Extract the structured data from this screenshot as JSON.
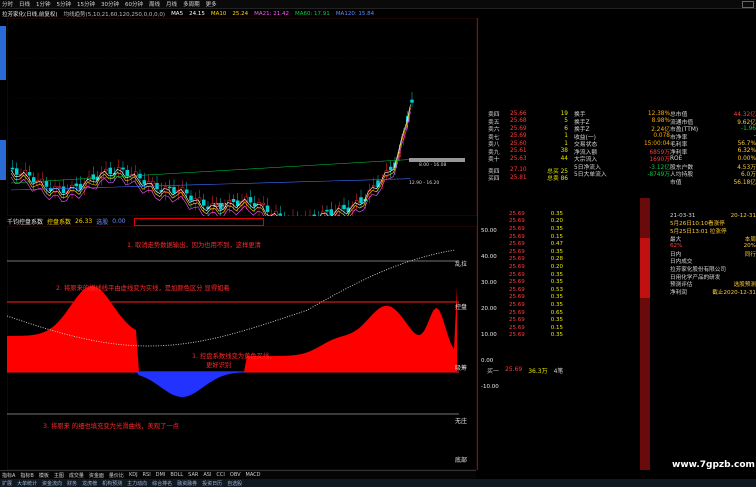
{
  "menu": [
    "分时",
    "日线",
    "1分钟",
    "5分钟",
    "15分钟",
    "30分钟",
    "60分钟",
    "周线",
    "月线",
    "多周期",
    "更多"
  ],
  "title": {
    "stock": "拉芳家化(日线,前复权)",
    "indicator": "均线趋势(5,10,21,60,120,250,0,0,0,0)",
    "ma5_label": "MA5",
    "ma5": "24.15",
    "ma10_label": "MA10",
    "ma10": "25.24",
    "ma21": "MA21: 21.42",
    "ma60": "MA60: 17.91",
    "ma120": "MA120: 15.84"
  },
  "chart_marks": {
    "price_high_tag": "↑",
    "low_label": "13.41",
    "box_labels": [
      "8.00 - 16.08",
      "12.90 - 16.20"
    ]
  },
  "indicator_header": {
    "name": "千钧控盘系数",
    "line1_label": "控盘系数",
    "line1_value": "26.33",
    "line2_label": "选股",
    "line2_value": "0.00"
  },
  "indicator_axis": [
    "50.00",
    "40.00",
    "30.00",
    "20.00",
    "10.00",
    "0.00",
    "-10.00"
  ],
  "indicator_zones": [
    "乱拉",
    "控盘",
    "吸筹",
    "无庄",
    "底部"
  ],
  "annotations": [
    "1. 取消走势数据输出，因为也用不到，这样更清",
    "2. 将原来的横线线平由虚线变为实线，是加颜色区分 显得如着",
    "1. 控盘系数线变为黄色叉线，",
    "更好识别",
    "3. 将原来 的细也填充变为光滑曲线，美观了一点"
  ],
  "bottom_tabs": [
    "指标A",
    "指标B",
    "模板",
    "主图",
    "成交量",
    "资金面",
    "量价比",
    "KDJ",
    "RSI",
    "DMI",
    "BOLL",
    "SAR",
    "ASI",
    "CCI",
    "OBV",
    "MACD"
  ],
  "status_tabs": [
    "扩展",
    "大单统计",
    "资金流向",
    "财务",
    "龙虎榜",
    "机构预测",
    "主力动向",
    "综合排名",
    "融资融券",
    "投资日历",
    "自选股"
  ],
  "order_book": {
    "sell": [
      {
        "label": "卖四",
        "price": "25.66",
        "vol": "19"
      },
      {
        "label": "卖五",
        "price": "25.68",
        "vol": "5"
      },
      {
        "label": "卖六",
        "price": "25.69",
        "vol": "6"
      },
      {
        "label": "卖七",
        "price": "25.69",
        "vol": "1"
      },
      {
        "label": "卖八",
        "price": "25.60",
        "vol": "1"
      },
      {
        "label": "卖九",
        "price": "25.61",
        "vol": "38"
      },
      {
        "label": "卖十",
        "price": "25.63",
        "vol": "44"
      }
    ],
    "buy": [
      {
        "label": "卖四",
        "price": "27.10",
        "vol": "总买 25"
      },
      {
        "label": "买四",
        "price": "25.81",
        "vol": "总卖 86"
      }
    ]
  },
  "quote_info": [
    {
      "k": "换手",
      "v": "12.38%"
    },
    {
      "k": "换手Z",
      "v": "8.98%"
    },
    {
      "k": "换手Z",
      "v": "2.24亿"
    },
    {
      "k": "收益(一)",
      "v": "0.078"
    },
    {
      "k": "交易状态",
      "v": "15:00:04"
    },
    {
      "k": "净流入额",
      "v": "6859万"
    },
    {
      "k": "大宗流入",
      "v": "1690万"
    },
    {
      "k": "5日净流入",
      "v": "-3.12亿"
    },
    {
      "k": "5日大单流入",
      "v": "-8749万"
    }
  ],
  "fund_info": [
    {
      "k": "总市值",
      "v": "44.32亿",
      "c": "r"
    },
    {
      "k": "流通市值",
      "v": "9.62亿",
      "c": "y"
    },
    {
      "k": "市盈(TTM)",
      "v": "-1.96",
      "c": "g"
    },
    {
      "k": "市净率",
      "v": "-",
      "c": "y"
    },
    {
      "k": "毛利率",
      "v": "56.7%",
      "c": "y"
    },
    {
      "k": "净利率",
      "v": "6.32%",
      "c": "y"
    },
    {
      "k": "ROE",
      "v": "0.00%",
      "c": "y"
    },
    {
      "k": "股东户数",
      "v": "4.53万",
      "c": "y"
    },
    {
      "k": "人均持股",
      "v": "6.0万",
      "c": "y"
    },
    {
      "k": "市值",
      "v": "56.18亿",
      "c": "y"
    }
  ],
  "ticks": [
    {
      "t": "",
      "p": "25.69",
      "n": "0.35"
    },
    {
      "t": "",
      "p": "25.69",
      "n": "0.20"
    },
    {
      "t": "",
      "p": "25.69",
      "n": "0.35"
    },
    {
      "t": "",
      "p": "25.69",
      "n": "0.15"
    },
    {
      "t": "",
      "p": "25.69",
      "n": "0.47"
    },
    {
      "t": "",
      "p": "25.69",
      "n": "0.35"
    },
    {
      "t": "",
      "p": "25.69",
      "n": "0.28"
    },
    {
      "t": "",
      "p": "25.69",
      "n": "0.20"
    },
    {
      "t": "",
      "p": "25.69",
      "n": "0.35"
    },
    {
      "t": "",
      "p": "25.69",
      "n": "0.35"
    },
    {
      "t": "",
      "p": "25.69",
      "n": "0.53"
    },
    {
      "t": "",
      "p": "25.69",
      "n": "0.35"
    },
    {
      "t": "",
      "p": "25.69",
      "n": "0.35"
    },
    {
      "t": "",
      "p": "25.69",
      "n": "0.65"
    },
    {
      "t": "",
      "p": "25.69",
      "n": "0.35"
    },
    {
      "t": "",
      "p": "25.69",
      "n": "0.15"
    },
    {
      "t": "",
      "p": "25.69",
      "n": "0.35"
    }
  ],
  "mid_summary": [
    "买一",
    "25.69",
    "36.3万",
    "4笔"
  ],
  "right_panel": [
    {
      "k": "21-03-31",
      "v": "20-12-31"
    },
    {
      "k": "5月26日10:10看涨停",
      "v": ""
    },
    {
      "k": "5月25日13:01 拉涨停",
      "v": ""
    },
    {
      "k": "最大",
      "v": "本周"
    },
    {
      "k": "62%",
      "v": "20%"
    },
    {
      "k": "日内",
      "v": "同行"
    },
    {
      "k": "日内成交",
      "v": ""
    },
    {
      "k": "拉芳家化股份有限公司",
      "v": ""
    },
    {
      "k": "日用化学产品的研发",
      "v": ""
    },
    {
      "k": "预测评估",
      "v": "选股预测"
    },
    {
      "k": "净利润",
      "v": "截止2020-12-31"
    }
  ],
  "watermark": "www.7gpzb.com"
}
